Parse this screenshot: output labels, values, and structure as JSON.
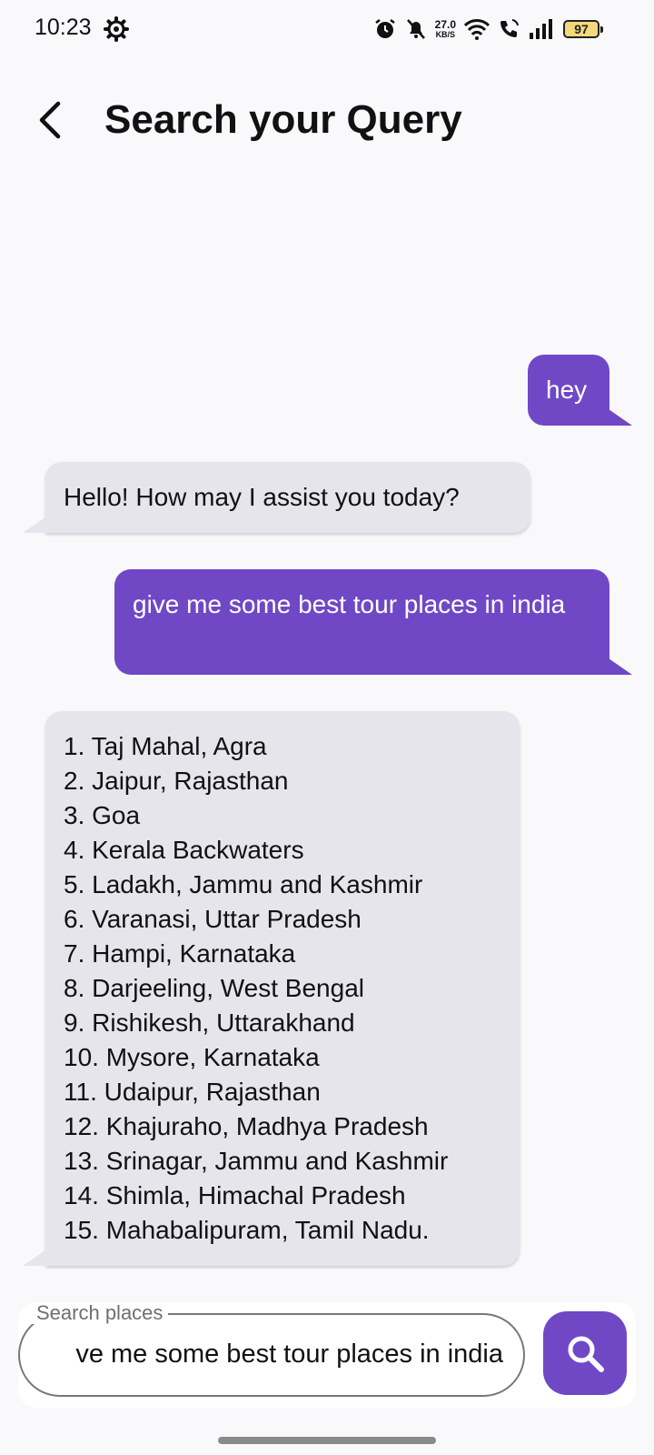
{
  "status_bar": {
    "time": "10:23",
    "net_speed_value": "27.0",
    "net_speed_unit": "KB/S",
    "battery": "97"
  },
  "header": {
    "title": "Search your Query"
  },
  "messages": [
    {
      "role": "user",
      "text": "hey"
    },
    {
      "role": "bot",
      "text": "Hello! How may I assist you today?"
    },
    {
      "role": "user",
      "text": "give me some best tour places in india"
    },
    {
      "role": "bot",
      "text": "1. Taj Mahal, Agra\n2. Jaipur, Rajasthan\n3. Goa\n4. Kerala Backwaters\n5. Ladakh, Jammu and Kashmir\n6. Varanasi, Uttar Pradesh\n7. Hampi, Karnataka\n8. Darjeeling, West Bengal\n9. Rishikesh, Uttarakhand\n10. Mysore, Karnataka\n11. Udaipur, Rajasthan\n12. Khajuraho, Madhya Pradesh\n13. Srinagar, Jammu and Kashmir\n14. Shimla, Himachal Pradesh\n15. Mahabalipuram, Tamil Nadu."
    }
  ],
  "search": {
    "label": "Search places",
    "value": "ve me some best tour places in india"
  },
  "colors": {
    "accent": "#7048c6",
    "bot_bubble": "#e6e5ec",
    "background": "#f9f9fb"
  },
  "icons": {
    "settings": "gear-icon",
    "back": "back-arrow-icon",
    "search": "search-icon"
  }
}
